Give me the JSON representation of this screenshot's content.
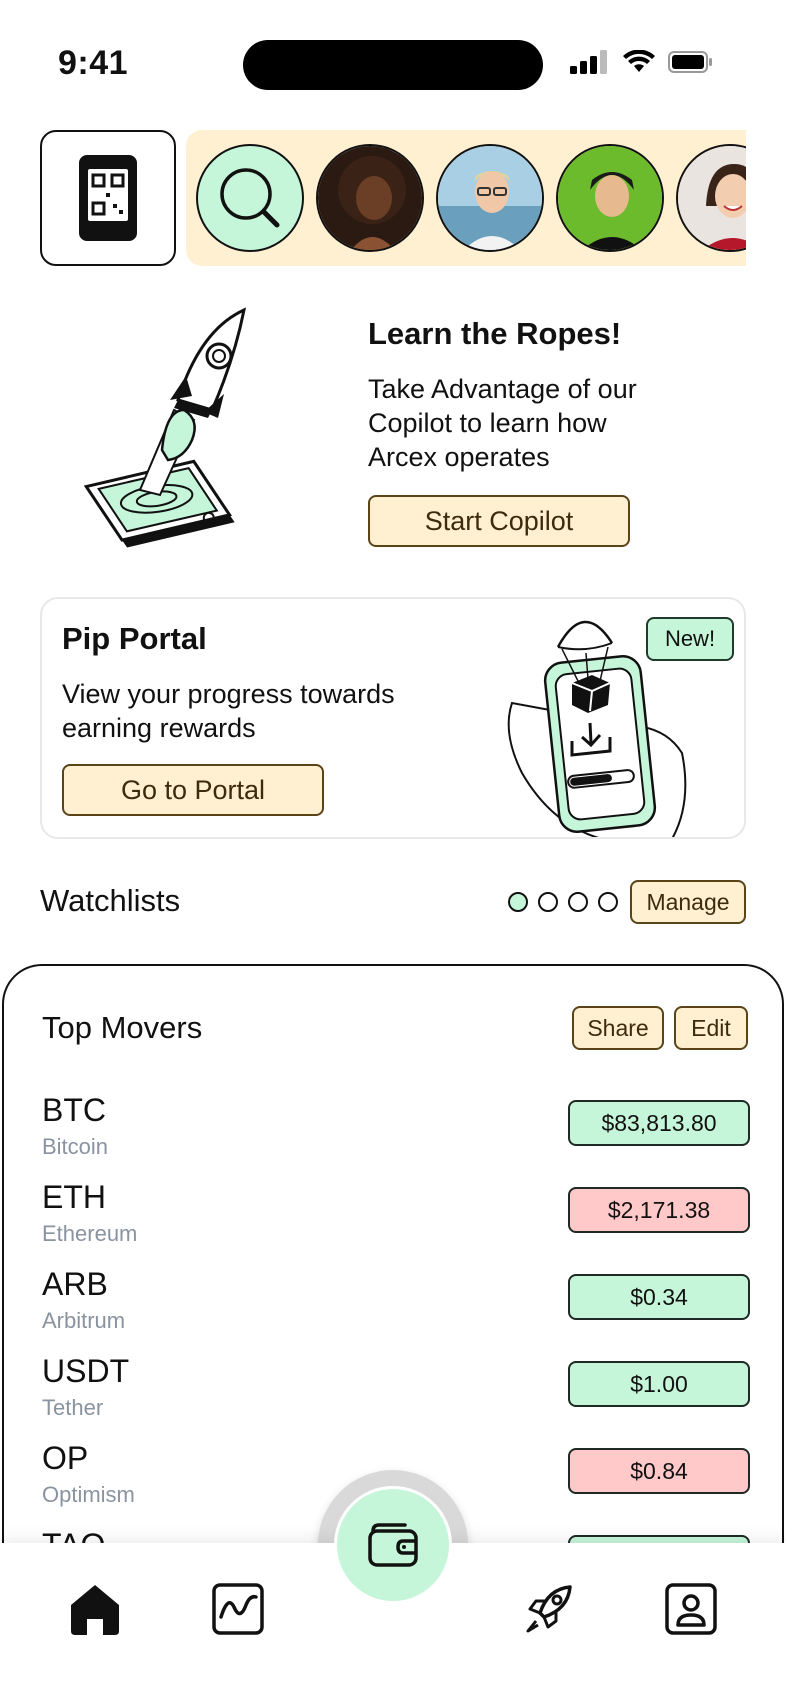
{
  "status_bar": {
    "time": "9:41"
  },
  "learn": {
    "title": "Learn the Ropes!",
    "text": "Take Advantage of our Copilot to learn how Arcex operates",
    "button": "Start Copilot"
  },
  "pip": {
    "title": "Pip Portal",
    "text": "View your progress towards earning rewards",
    "button": "Go to Portal",
    "badge": "New!"
  },
  "watchlists": {
    "title": "Watchlists",
    "manage": "Manage",
    "pages": 4,
    "active_page": 1
  },
  "top_movers": {
    "title": "Top Movers",
    "share": "Share",
    "edit": "Edit",
    "rows": [
      {
        "symbol": "BTC",
        "name": "Bitcoin",
        "price": "$83,813.80",
        "trend": "up"
      },
      {
        "symbol": "ETH",
        "name": "Ethereum",
        "price": "$2,171.38",
        "trend": "down"
      },
      {
        "symbol": "ARB",
        "name": "Arbitrum",
        "price": "$0.34",
        "trend": "up"
      },
      {
        "symbol": "USDT",
        "name": "Tether",
        "price": "$1.00",
        "trend": "up"
      },
      {
        "symbol": "OP",
        "name": "Optimism",
        "price": "$0.84",
        "trend": "down"
      },
      {
        "symbol": "TAO",
        "name": "",
        "price": "",
        "trend": "up"
      }
    ]
  },
  "colors": {
    "accent_green": "#c6f6d9",
    "accent_red": "#ffc9c9",
    "cream": "#fff0d2",
    "brown_border": "#5c4419"
  },
  "nav": {
    "items": [
      "home-icon",
      "chart-icon",
      "wallet-icon",
      "rocket-icon",
      "profile-icon"
    ],
    "active": "home-icon"
  }
}
